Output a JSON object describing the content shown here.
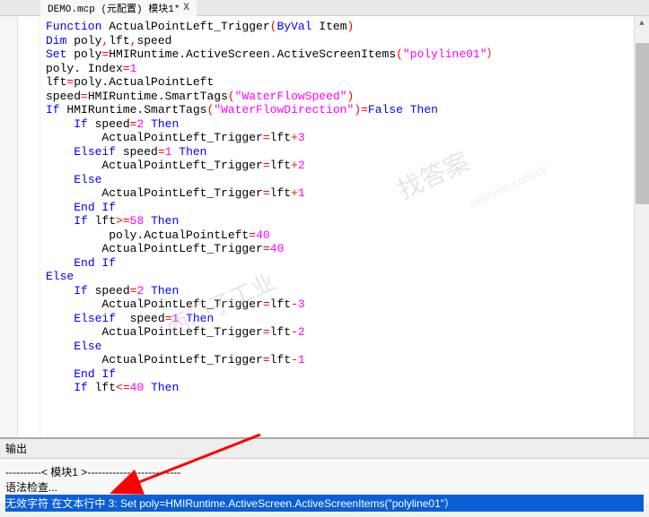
{
  "tab": {
    "label": "DEMO.mcp (元配置) 模块1*",
    "close": "X"
  },
  "code": {
    "lines": [
      {
        "indent": 0,
        "tokens": [
          [
            "kw",
            "Function"
          ],
          [
            "",
            " ActualPointLeft_Trigger"
          ],
          [
            "op",
            "("
          ],
          [
            "kw",
            "ByVal"
          ],
          [
            "",
            " Item"
          ],
          [
            "op",
            ")"
          ]
        ]
      },
      {
        "indent": 0,
        "tokens": [
          [
            "kw",
            "Dim"
          ],
          [
            "",
            " poly"
          ],
          [
            "op",
            ","
          ],
          [
            "",
            "lft"
          ],
          [
            "op",
            ","
          ],
          [
            "",
            "speed"
          ]
        ]
      },
      {
        "indent": 0,
        "tokens": [
          [
            "kw",
            "Set"
          ],
          [
            "",
            " poly"
          ],
          [
            "op",
            "="
          ],
          [
            "",
            "HMIRuntime.ActiveScreen.ActiveScreenItems"
          ],
          [
            "op",
            "("
          ],
          [
            "str",
            "\"polyline01\""
          ],
          [
            "op",
            "）"
          ]
        ]
      },
      {
        "indent": 0,
        "tokens": [
          [
            "",
            "poly. Index"
          ],
          [
            "op",
            "="
          ],
          [
            "num",
            "1"
          ]
        ]
      },
      {
        "indent": 0,
        "tokens": [
          [
            "",
            "lft"
          ],
          [
            "op",
            "="
          ],
          [
            "",
            "poly.ActualPointLeft"
          ]
        ]
      },
      {
        "indent": 0,
        "tokens": [
          [
            "",
            "speed"
          ],
          [
            "op",
            "="
          ],
          [
            "",
            "HMIRuntime.SmartTags"
          ],
          [
            "op",
            "("
          ],
          [
            "str",
            "\"WaterFlowSpeed\""
          ],
          [
            "op",
            ")"
          ]
        ]
      },
      {
        "indent": 0,
        "tokens": [
          [
            "kw",
            "If"
          ],
          [
            "",
            " HMIRuntime.SmartTags"
          ],
          [
            "op",
            "("
          ],
          [
            "str",
            "\"WaterFlowDirection\""
          ],
          [
            "op",
            ")="
          ],
          [
            "kw",
            "False"
          ],
          [
            "",
            " "
          ],
          [
            "kw",
            "Then"
          ]
        ]
      },
      {
        "indent": 1,
        "tokens": [
          [
            "kw",
            "If"
          ],
          [
            "",
            " speed"
          ],
          [
            "op",
            "="
          ],
          [
            "num",
            "2"
          ],
          [
            "",
            " "
          ],
          [
            "kw",
            "Then"
          ]
        ]
      },
      {
        "indent": 2,
        "tokens": [
          [
            "",
            "ActualPointLeft_Trigger"
          ],
          [
            "op",
            "="
          ],
          [
            "",
            "lft"
          ],
          [
            "op",
            "+"
          ],
          [
            "num",
            "3"
          ]
        ]
      },
      {
        "indent": 1,
        "tokens": [
          [
            "kw",
            "Elseif"
          ],
          [
            "",
            " speed"
          ],
          [
            "op",
            "="
          ],
          [
            "num",
            "1"
          ],
          [
            "",
            " "
          ],
          [
            "kw",
            "Then"
          ]
        ]
      },
      {
        "indent": 2,
        "tokens": [
          [
            "",
            "ActualPointLeft_Trigger"
          ],
          [
            "op",
            "="
          ],
          [
            "",
            "lft"
          ],
          [
            "op",
            "+"
          ],
          [
            "num",
            "2"
          ]
        ]
      },
      {
        "indent": 1,
        "tokens": [
          [
            "kw",
            "Else"
          ]
        ]
      },
      {
        "indent": 2,
        "tokens": [
          [
            "",
            "ActualPointLeft_Trigger"
          ],
          [
            "op",
            "="
          ],
          [
            "",
            "lft"
          ],
          [
            "op",
            "+"
          ],
          [
            "num",
            "1"
          ]
        ],
        "cursor": true
      },
      {
        "indent": 1,
        "tokens": [
          [
            "kw",
            "End If"
          ]
        ]
      },
      {
        "indent": 1,
        "tokens": [
          [
            "kw",
            "If"
          ],
          [
            "",
            " lft"
          ],
          [
            "op",
            ">="
          ],
          [
            "num",
            "58"
          ],
          [
            "",
            " "
          ],
          [
            "kw",
            "Then"
          ]
        ]
      },
      {
        "indent": 2,
        "tokens": [
          [
            "",
            " poly.ActualPointLeft"
          ],
          [
            "op",
            "="
          ],
          [
            "num",
            "40"
          ]
        ]
      },
      {
        "indent": 2,
        "tokens": [
          [
            "",
            "ActualPointLeft_Trigger"
          ],
          [
            "op",
            "="
          ],
          [
            "num",
            "40"
          ]
        ]
      },
      {
        "indent": 1,
        "tokens": [
          [
            "kw",
            "End If"
          ]
        ]
      },
      {
        "indent": 0,
        "tokens": [
          [
            "kw",
            "Else"
          ]
        ]
      },
      {
        "indent": 1,
        "tokens": [
          [
            "kw",
            "If"
          ],
          [
            "",
            " speed"
          ],
          [
            "op",
            "="
          ],
          [
            "num",
            "2"
          ],
          [
            "",
            " "
          ],
          [
            "kw",
            "Then"
          ]
        ]
      },
      {
        "indent": 2,
        "tokens": [
          [
            "",
            "ActualPointLeft_Trigger"
          ],
          [
            "op",
            "="
          ],
          [
            "",
            "lft"
          ],
          [
            "op",
            "-"
          ],
          [
            "num",
            "3"
          ]
        ]
      },
      {
        "indent": 1,
        "tokens": [
          [
            "kw",
            "Elseif"
          ],
          [
            "",
            "  speed"
          ],
          [
            "op",
            "="
          ],
          [
            "num",
            "1"
          ],
          [
            "",
            " "
          ],
          [
            "kw",
            "Then"
          ]
        ]
      },
      {
        "indent": 2,
        "tokens": [
          [
            "",
            "ActualPointLeft_Trigger"
          ],
          [
            "op",
            "="
          ],
          [
            "",
            "lft"
          ],
          [
            "op",
            "-"
          ],
          [
            "num",
            "2"
          ]
        ]
      },
      {
        "indent": 1,
        "tokens": [
          [
            "kw",
            "Else"
          ]
        ]
      },
      {
        "indent": 2,
        "tokens": [
          [
            "",
            "ActualPointLeft_Trigger"
          ],
          [
            "op",
            "="
          ],
          [
            "",
            "lft"
          ],
          [
            "op",
            "-"
          ],
          [
            "num",
            "1"
          ]
        ]
      },
      {
        "indent": 1,
        "tokens": [
          [
            "kw",
            "End If"
          ]
        ]
      },
      {
        "indent": 1,
        "tokens": [
          [
            "kw",
            "If"
          ],
          [
            "",
            " lft"
          ],
          [
            "op",
            "<="
          ],
          [
            "num",
            "40"
          ],
          [
            "",
            " "
          ],
          [
            "kw",
            "Then"
          ]
        ]
      }
    ]
  },
  "output": {
    "title": "输出",
    "divider": "----------< 模块1 >--------------------------",
    "syntax": "语法检查...",
    "error": "无效字符 在文本行中 3: Set poly=HMIRuntime.ActiveScreen.ActiveScreenItems(\"polyline01\"）"
  },
  "watermarks": {
    "wm1": "找答案",
    "wm2": "找答案",
    "wm3": "西门子工业",
    "wm4": "supportindustry.siemens.com/cs",
    "wm5": "siemens.com/cs"
  }
}
